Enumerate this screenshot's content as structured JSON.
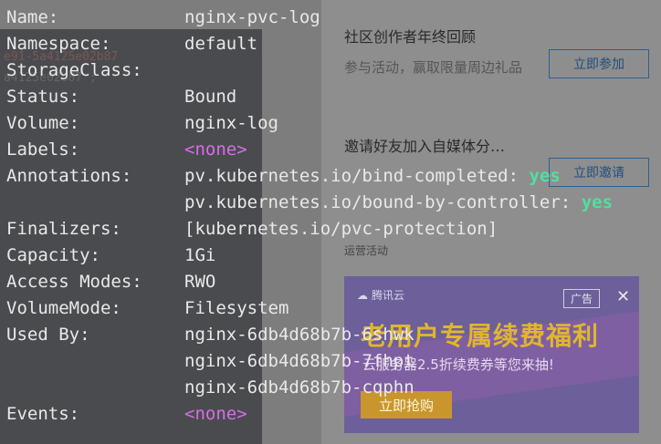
{
  "background": {
    "ghost_text_1": "e91-5a4125e02b87",
    "ghost_text_2": "a4125e02b87 ;",
    "sidebar": {
      "promo1_title": "社区创作者年终回顾",
      "promo1_desc": "参与活动，赢取限量周边礼品",
      "promo1_button": "立即参加",
      "promo2_title": "邀请好友加入自媒体分…",
      "promo2_button": "立即邀请",
      "section_label": "运营活动",
      "ad": {
        "logo_text": "腾讯云",
        "tag": "广告",
        "close": "✕",
        "headline": "老用户专属续费福利",
        "subline": "云服务器2.5折续费券等您来抽!",
        "button": "立即抢购"
      }
    }
  },
  "terminal": {
    "name": {
      "key": "Name:",
      "value": "nginx-pvc-log"
    },
    "namespace": {
      "key": "Namespace:",
      "value": "default"
    },
    "storageclass": {
      "key": "StorageClass:",
      "value": ""
    },
    "status": {
      "key": "Status:",
      "value": "Bound"
    },
    "volume": {
      "key": "Volume:",
      "value": "nginx-log"
    },
    "labels": {
      "key": "Labels:",
      "value": "<none>"
    },
    "annotations": {
      "key": "Annotations:",
      "line1_key": "pv.kubernetes.io/bind-completed:",
      "line1_val": "yes",
      "line2_key": "pv.kubernetes.io/bound-by-controller:",
      "line2_val": "yes"
    },
    "finalizers": {
      "key": "Finalizers:",
      "value": "[kubernetes.io/pvc-protection]"
    },
    "capacity": {
      "key": "Capacity:",
      "value": "1Gi"
    },
    "access_modes": {
      "key": "Access Modes:",
      "value": "RWO"
    },
    "volume_mode": {
      "key": "VolumeMode:",
      "value": "Filesystem"
    },
    "used_by": {
      "key": "Used By:",
      "values": [
        "nginx-6db4d68b7b-6shwk",
        "nginx-6db4d68b7b-7fhpt",
        "nginx-6db4d68b7b-cqphn"
      ]
    },
    "events": {
      "key": "Events:",
      "value": "<none>"
    }
  }
}
